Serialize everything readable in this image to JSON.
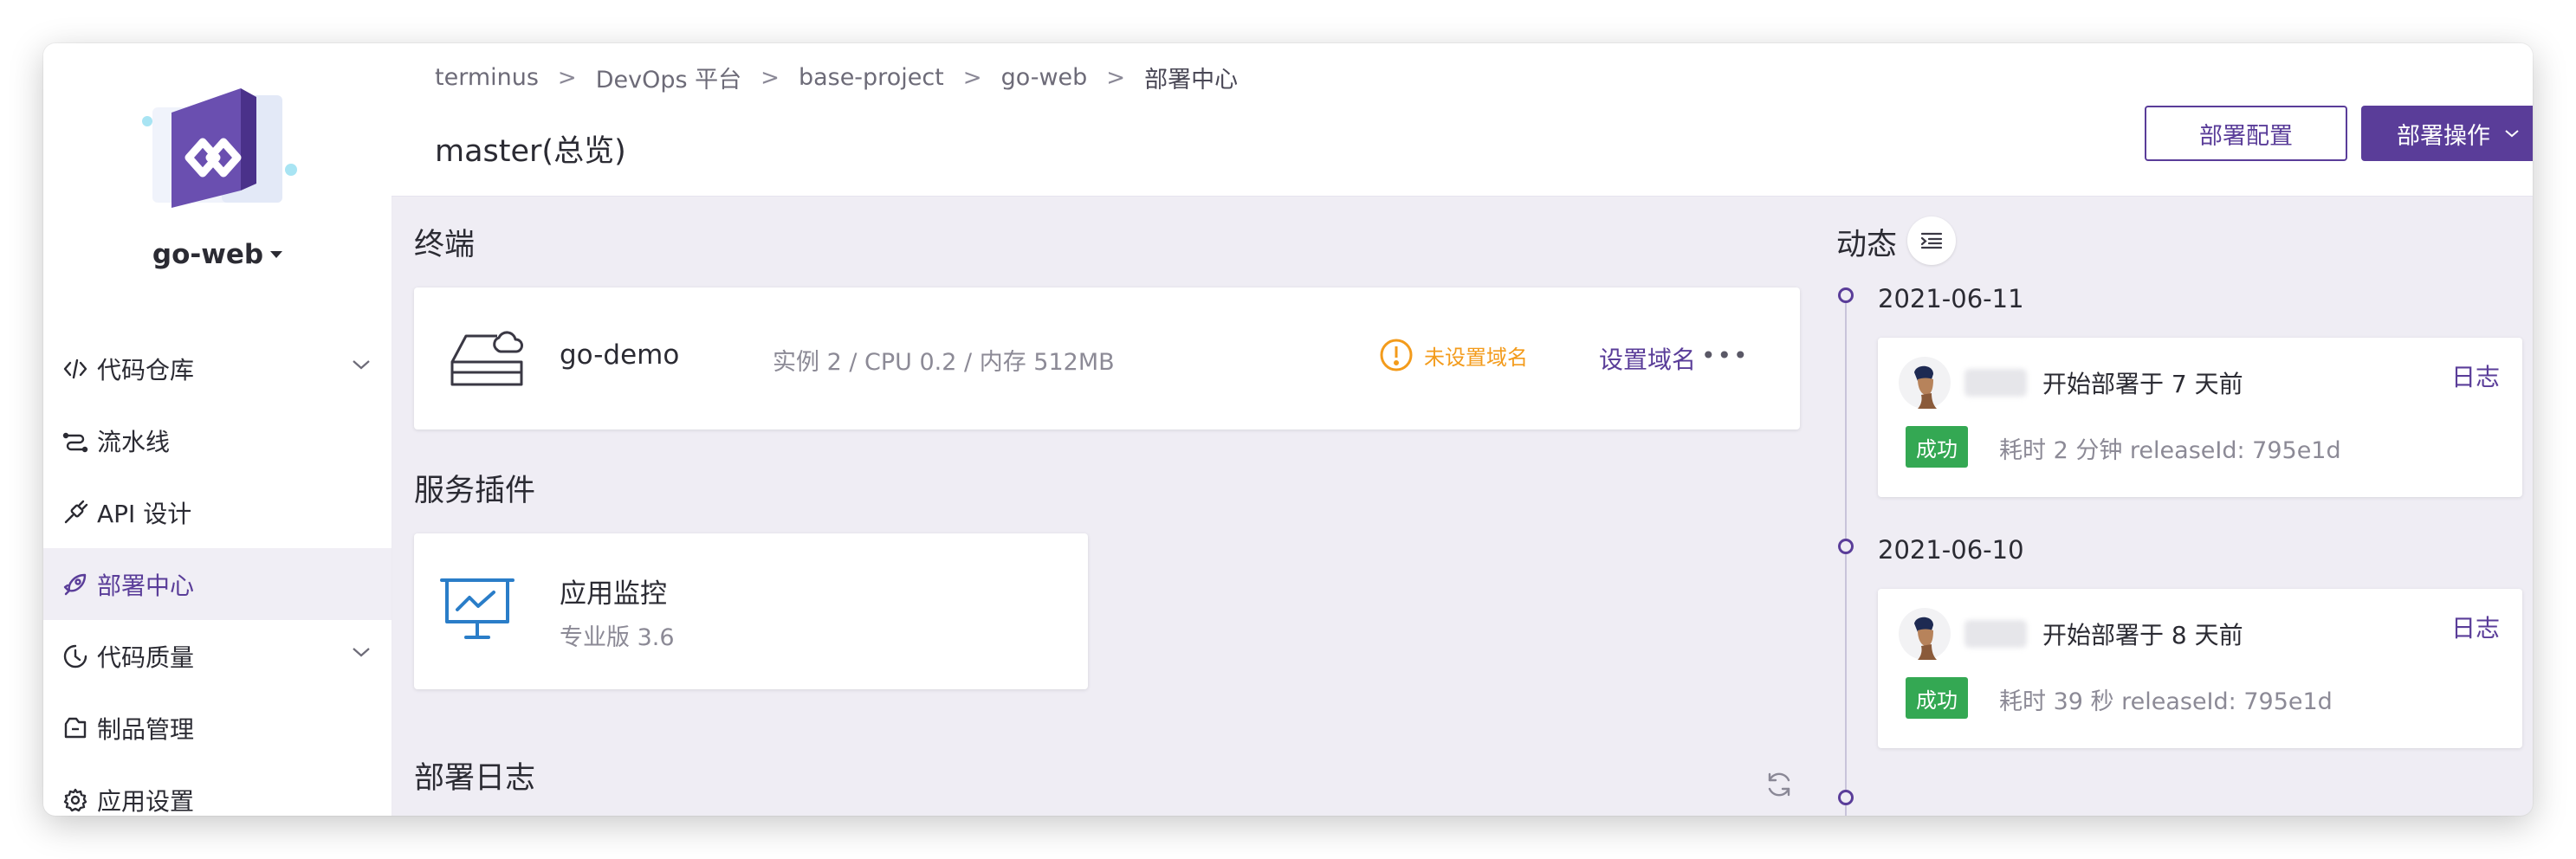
{
  "app": {
    "name": "go-web"
  },
  "sidebar": {
    "items": [
      {
        "label": "代码仓库",
        "icon": "code-icon",
        "has_children": true,
        "active": false
      },
      {
        "label": "流水线",
        "icon": "pipeline-icon",
        "has_children": false,
        "active": false
      },
      {
        "label": "API 设计",
        "icon": "api-icon",
        "has_children": false,
        "active": false
      },
      {
        "label": "部署中心",
        "icon": "rocket-icon",
        "has_children": false,
        "active": true
      },
      {
        "label": "代码质量",
        "icon": "quality-icon",
        "has_children": true,
        "active": false
      },
      {
        "label": "制品管理",
        "icon": "package-icon",
        "has_children": false,
        "active": false
      },
      {
        "label": "应用设置",
        "icon": "gear-icon",
        "has_children": false,
        "active": false
      }
    ]
  },
  "header": {
    "breadcrumb": [
      "terminus",
      "DevOps 平台",
      "base-project",
      "go-web",
      "部署中心"
    ],
    "separator": ">",
    "title": "master(总览)",
    "deploy_config_label": "部署配置",
    "deploy_action_label": "部署操作"
  },
  "main": {
    "terminal": {
      "title": "终端",
      "name": "go-demo",
      "spec": "实例 2 / CPU 0.2 / 内存 512MB",
      "warning": "未设置域名",
      "link": "设置域名",
      "more": "•••"
    },
    "plugins": {
      "title": "服务插件",
      "name": "应用监控",
      "version": "专业版  3.6"
    },
    "deploy_log": {
      "title": "部署日志"
    }
  },
  "activity": {
    "title": "动态",
    "records": [
      {
        "date": "2021-06-11",
        "text": "开始部署于 7 天前",
        "log_label": "日志",
        "status": "成功",
        "meta": "耗时 2 分钟  releaseId: 795e1d"
      },
      {
        "date": "2021-06-10",
        "text": "开始部署于 8 天前",
        "log_label": "日志",
        "status": "成功",
        "meta": "耗时 39 秒  releaseId: 795e1d"
      }
    ]
  },
  "colors": {
    "brand": "#5a3d99",
    "warning": "#f39b1b",
    "success": "#34a853",
    "background": "#efedf4"
  }
}
